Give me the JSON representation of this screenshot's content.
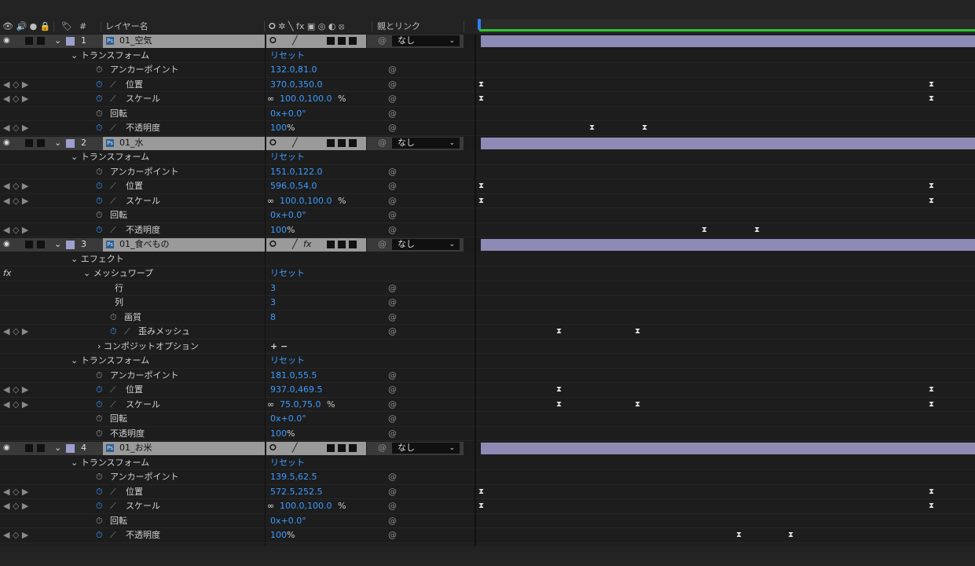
{
  "header": {
    "switch_icons": "👁 🔊 ● 🔒",
    "label_icon": "🏷",
    "index_label": "#",
    "layer_name": "レイヤー名",
    "switches": "🞇 ✲ ╲ fx ▣ ◎ ◐ ⦻",
    "parent_link": "親とリンク"
  },
  "layers": [
    {
      "num": "1",
      "name": "01_空気",
      "parent": "なし",
      "fx": false
    },
    {
      "num": "2",
      "name": "01_水",
      "parent": "なし",
      "fx": false
    },
    {
      "num": "3",
      "name": "01_食べもの",
      "parent": "なし",
      "fx": true
    },
    {
      "num": "4",
      "name": "01_お米",
      "parent": "なし",
      "fx": false
    }
  ],
  "groups": {
    "transform": "トランスフォーム",
    "effect": "エフェクト",
    "meshwarp": "メッシュワープ",
    "composite": "コンポジットオプション",
    "reset": "リセット",
    "plusminus": "+ −"
  },
  "props": {
    "anchor": "アンカーポイント",
    "position": "位置",
    "scale": "スケール",
    "rotation": "回転",
    "opacity": "不透明度",
    "rows": "行",
    "cols": "列",
    "quality": "画質",
    "distortion": "歪みメッシュ"
  },
  "values": {
    "l1_anchor": "132.0,81.0",
    "l1_position": "370.0,350.0",
    "l1_scale": "100.0,100.0",
    "l1_rotation": "0x+0.0°",
    "l1_opacity": "100",
    "l2_anchor": "151.0,122.0",
    "l2_position": "596.0,54.0",
    "l2_scale": "100.0,100.0",
    "l2_rotation": "0x+0.0°",
    "l2_opacity": "100",
    "l3_rows": "3",
    "l3_cols": "3",
    "l3_quality": "8",
    "l3_anchor": "181.0,55.5",
    "l3_position": "937.0,469.5",
    "l3_scale": "75.0,75.0",
    "l3_rotation": "0x+0.0°",
    "l3_opacity": "100",
    "l4_anchor": "139.5,62.5",
    "l4_position": "572.5,252.5",
    "l4_scale": "100.0,100.0",
    "l4_rotation": "0x+0.0°",
    "l4_opacity": "100",
    "percent": "%"
  },
  "colors": {
    "accent_blue": "#3d9bff",
    "layer_bar": "#8d8bb5",
    "label_lavender": "#9da0cf",
    "work_area_green": "#2ec52e"
  }
}
